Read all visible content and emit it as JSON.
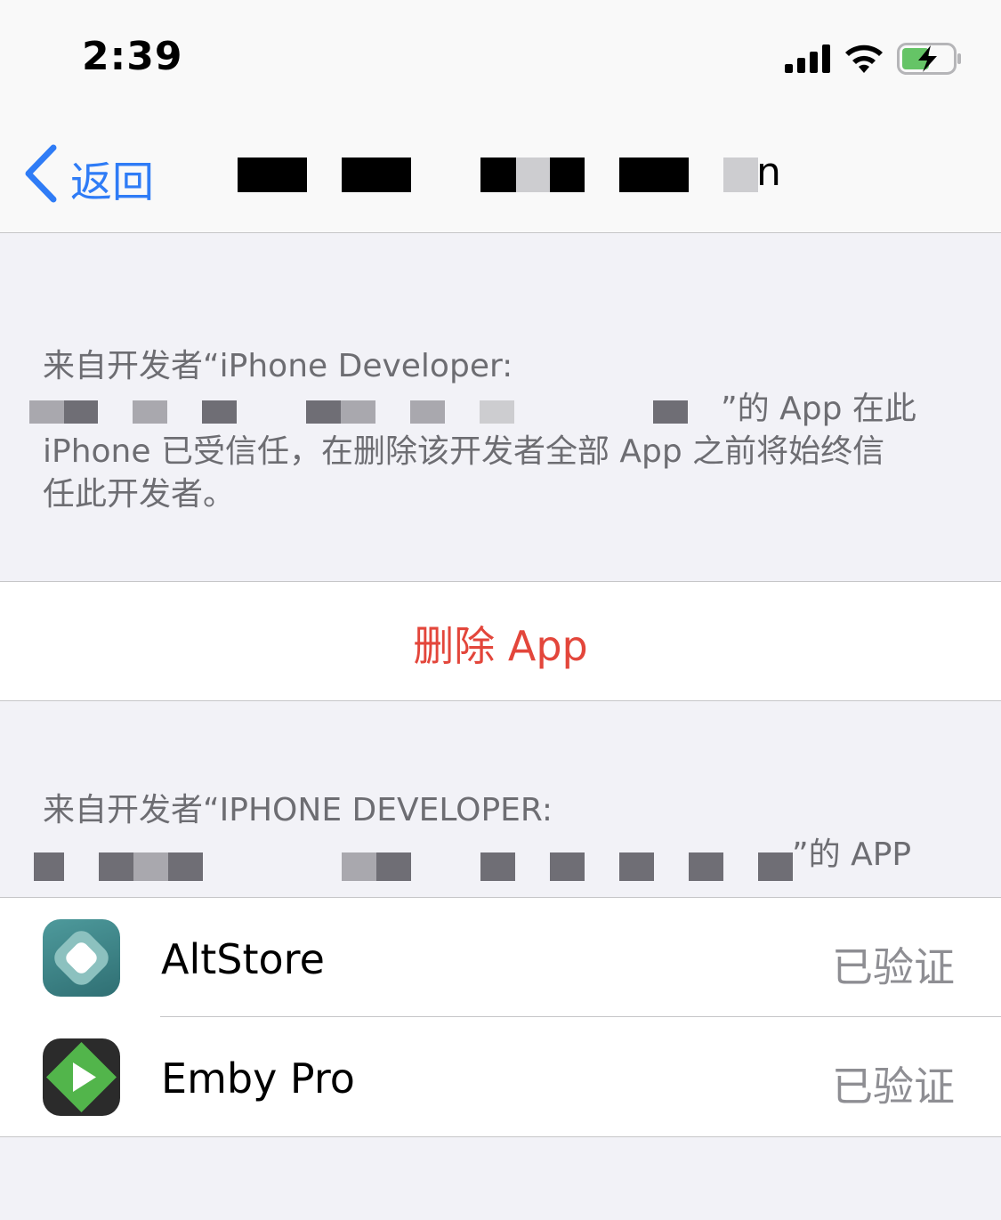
{
  "status_bar": {
    "time": "2:39"
  },
  "nav": {
    "back_label": "返回",
    "title_visible_suffix": "n"
  },
  "trust_section": {
    "line1": "来自开发者“iPhone Developer:",
    "line2_tail": "”的 App 在此",
    "line3": "iPhone 已受信任，在删除该开发者全部 App 之前将始终信",
    "line4": "任此开发者。"
  },
  "delete_button": {
    "label": "删除 App"
  },
  "apps_section": {
    "header_line1": "来自开发者“IPHONE DEVELOPER:",
    "header_line2_tail": "”的 APP",
    "apps": [
      {
        "name": "AltStore",
        "status": "已验证",
        "icon": "altstore-icon"
      },
      {
        "name": "Emby Pro",
        "status": "已验证",
        "icon": "emby-icon"
      }
    ]
  },
  "colors": {
    "accent_blue": "#2f7cf6",
    "destructive_red": "#e3463b",
    "secondary_text": "#6d6d72",
    "grouped_background": "#f2f2f7",
    "battery_charging_green": "#65c466"
  }
}
